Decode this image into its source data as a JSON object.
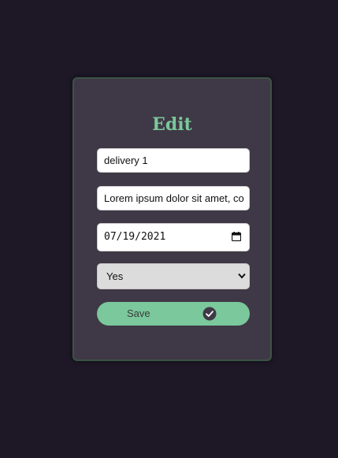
{
  "form": {
    "title": "Edit",
    "name_value": "delivery 1",
    "description_value": "Lorem ipsum dolor sit amet, co",
    "date_value": "07/19/2021",
    "select_value": "Yes",
    "save_label": "Save"
  },
  "icons": {
    "calendar": "calendar-icon",
    "chevron": "chevron-down-icon",
    "check": "check-circle-icon"
  },
  "colors": {
    "background": "#1d1726",
    "card": "#3f3846",
    "accent": "#7ac89b"
  }
}
